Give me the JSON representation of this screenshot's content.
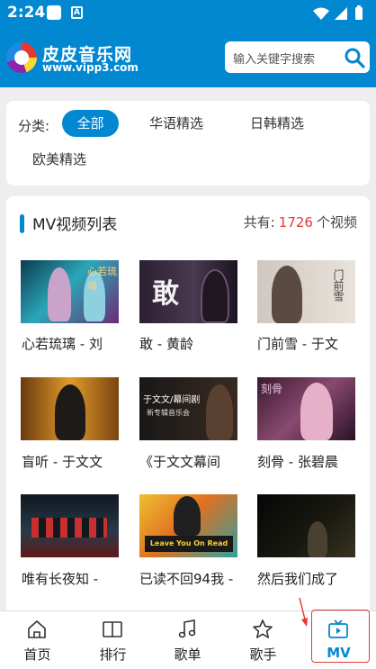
{
  "status": {
    "time": "2:24",
    "app_icon_letter": "A"
  },
  "header": {
    "logo_title": "皮皮音乐网",
    "logo_sub": "www.vipp3.com",
    "search_placeholder": "输入关键字搜索"
  },
  "categories": {
    "label": "分类:",
    "items": [
      "全部",
      "华语精选",
      "日韩精选",
      "欧美精选"
    ],
    "active": "全部"
  },
  "list": {
    "title": "MV视频列表",
    "count_prefix": "共有:",
    "count": "1726",
    "count_suffix": "个视频"
  },
  "videos": [
    {
      "caption": "心若琉璃 - 刘"
    },
    {
      "caption": "敢 - 黄龄"
    },
    {
      "caption": "门前雪 - 于文"
    },
    {
      "caption": "盲听 - 于文文"
    },
    {
      "caption": "《于文文幕间"
    },
    {
      "caption": "刻骨 - 张碧晨"
    },
    {
      "caption": "唯有长夜知 -"
    },
    {
      "caption": "已读不回94我 -"
    },
    {
      "caption": "然后我们成了"
    }
  ],
  "thumb_text": {
    "t1": "心若琉璃",
    "t2": "敢",
    "t3": "门前雪",
    "t4a": "于文文/幕间剧",
    "t4b": "新专辑音乐会",
    "t5": "刻骨",
    "t6": "Leave You On Read"
  },
  "nav": [
    {
      "label": "首页",
      "icon": "home-icon"
    },
    {
      "label": "排行",
      "icon": "book-icon"
    },
    {
      "label": "歌单",
      "icon": "music-note-icon"
    },
    {
      "label": "歌手",
      "icon": "star-icon"
    },
    {
      "label": "MV",
      "icon": "tv-icon"
    }
  ],
  "colors": {
    "primary": "#0288d1",
    "accent_red": "#e53935"
  }
}
